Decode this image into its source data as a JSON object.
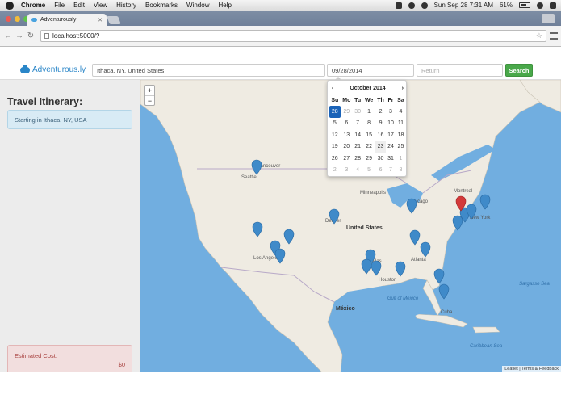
{
  "os_menu": {
    "items": [
      "Chrome",
      "File",
      "Edit",
      "View",
      "History",
      "Bookmarks",
      "Window",
      "Help"
    ],
    "clock": "Sun Sep 28  7:31 AM",
    "battery": "61%"
  },
  "browser": {
    "tab_title": "Adventurously",
    "url": "localhost:5000/?"
  },
  "app": {
    "brand": "Adventurous.ly",
    "origin_value": "Ithaca, NY, United States",
    "depart_value": "09/28/2014",
    "return_placeholder": "Return",
    "search_label": "Search"
  },
  "sidebar": {
    "title": "Travel Itinerary:",
    "start_text": "Starting in Ithaca, NY, USA",
    "cost_label": "Estimated Cost:",
    "cost_value": "$0"
  },
  "datepicker": {
    "prev": "‹",
    "next": "›",
    "month": "October 2014",
    "weekdays": [
      "Su",
      "Mo",
      "Tu",
      "We",
      "Th",
      "Fr",
      "Sa"
    ],
    "weeks": [
      [
        "28",
        "29",
        "30",
        "1",
        "2",
        "3",
        "4"
      ],
      [
        "5",
        "6",
        "7",
        "8",
        "9",
        "10",
        "11"
      ],
      [
        "12",
        "13",
        "14",
        "15",
        "16",
        "17",
        "18"
      ],
      [
        "19",
        "20",
        "21",
        "22",
        "23",
        "24",
        "25"
      ],
      [
        "26",
        "27",
        "28",
        "29",
        "30",
        "31",
        "1"
      ],
      [
        "2",
        "3",
        "4",
        "5",
        "6",
        "7",
        "8"
      ]
    ]
  },
  "map": {
    "labels": [
      "Vancouver",
      "Seattle",
      "Minneapolis",
      "Chicago",
      "Denver",
      "United States",
      "Los Angeles",
      "Dallas",
      "Houston",
      "Atlanta",
      "Montreal",
      "New York",
      "México",
      "Gulf of Mexico",
      "Sargasso Sea",
      "Caribbean Sea",
      "Cuba"
    ],
    "zoom_in": "+",
    "zoom_out": "−",
    "attribution": "Leaflet | Terms & Feedback",
    "colors": {
      "water": "#71aee0",
      "land": "#efebe2",
      "marker": "#3f8ac9",
      "origin_marker": "#d33a3a"
    }
  }
}
